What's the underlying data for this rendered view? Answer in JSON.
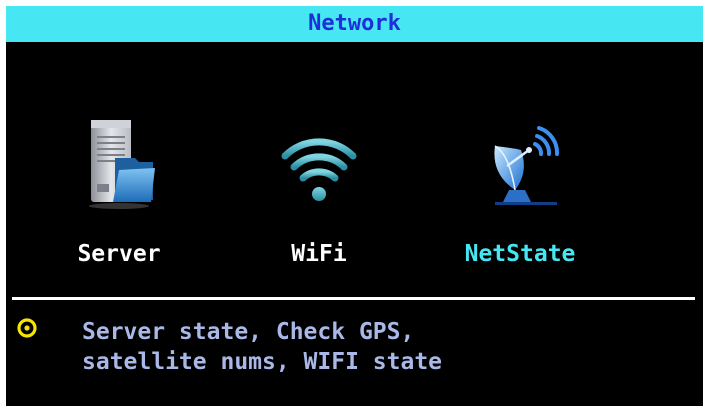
{
  "header": {
    "title": "Network"
  },
  "menu": {
    "selected_index": 2,
    "items": [
      {
        "label": "Server",
        "icon": "server-folder-icon"
      },
      {
        "label": "WiFi",
        "icon": "wifi-icon"
      },
      {
        "label": "NetState",
        "icon": "satellite-dish-icon"
      }
    ]
  },
  "hint": {
    "icon": "info-ring-icon",
    "line1": "Server state, Check GPS,",
    "line2": "satellite nums, WIFI state"
  },
  "colors": {
    "title_bar": "#46e6f3",
    "title_text": "#1f2fd8",
    "selected_label": "#46e6f3",
    "hint_text": "#a9b8e6",
    "hint_icon": "#f5e400",
    "background": "#000000"
  }
}
